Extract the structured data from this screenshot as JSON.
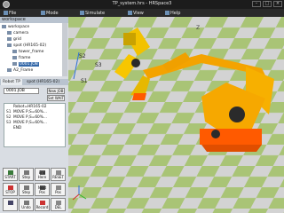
{
  "window": {
    "title": "TP_system.hrs - HRSpace3",
    "ctrl_min": "–",
    "ctrl_max": "□",
    "ctrl_close": "×"
  },
  "menu": [
    "File",
    "Mode",
    "Simulate",
    "View",
    "Help"
  ],
  "panel": {
    "title": "workspace",
    "tree": [
      "workspace",
      "camera",
      "grid",
      "spot (HR165-02)",
      "tower_frame",
      "frame",
      "0001.JOB",
      "A2_Frame"
    ],
    "selected_index": 6
  },
  "tabs": [
    "Robot TP",
    "spot (HR165-02)"
  ],
  "job": {
    "name": "0001.JOB",
    "new_job": "New JOB",
    "set_wait": "Set WAIT"
  },
  "program": [
    {
      "no": "",
      "text": "Robot=HR165-02"
    },
    {
      "no": "S1",
      "text": "MOVE P,S=60%..."
    },
    {
      "no": "S2",
      "text": "MOVE P,S=60%..."
    },
    {
      "no": "S3",
      "text": "MOVE P,S=60%..."
    },
    {
      "no": "",
      "text": "END"
    }
  ],
  "buttons": [
    {
      "label": "START",
      "icon": "play-icon"
    },
    {
      "label": "Step",
      "icon": "step-icon"
    },
    {
      "label": "End Here",
      "icon": "end-icon"
    },
    {
      "label": "RESET",
      "icon": "reset-icon"
    },
    {
      "label": "STOP",
      "icon": "stop-icon"
    },
    {
      "label": "Step",
      "icon": "step-back-icon"
    },
    {
      "label": "Next Pos",
      "icon": "next-icon"
    },
    {
      "label": "Pos",
      "icon": "pos-icon"
    },
    {
      "label": "",
      "icon": "speaker-icon"
    },
    {
      "label": "Undo",
      "icon": "undo-icon"
    },
    {
      "label": "Record",
      "icon": "record-icon"
    },
    {
      "label": "DEL",
      "icon": "delete-icon"
    }
  ],
  "scene": {
    "labels": [
      "S1",
      "S2",
      "S3",
      "Z"
    ]
  },
  "colors": {
    "robot": "#f7c600",
    "robot_orange": "#f4a300",
    "base": "#ff5a00",
    "floor_green": "#a9c476",
    "floor_grey": "#d3d3d3"
  }
}
